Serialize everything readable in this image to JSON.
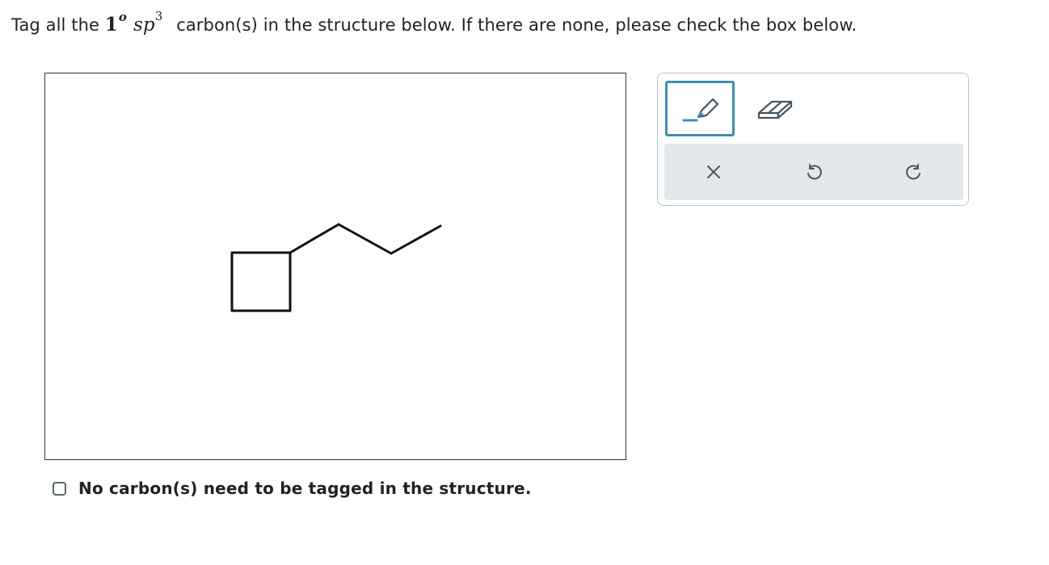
{
  "question": {
    "prefix": "Tag all the",
    "degree_number": "1",
    "degree_superscript": "o",
    "hybridization": "sp",
    "hybridization_superscript": "3",
    "suffix": "carbon(s) in the structure below. If there are none, please check the box below."
  },
  "checkbox": {
    "label": "No carbon(s) need to be tagged in the structure.",
    "checked": false
  },
  "toolbar": {
    "tools": [
      "pencil-icon",
      "eraser-icon"
    ],
    "actions": [
      "close-icon",
      "undo-icon",
      "redo-icon"
    ],
    "active_tool": "pencil-icon"
  },
  "colors": {
    "accent": "#3f8fae",
    "action_bar_bg": "#e3e8ed",
    "icon": "#4a5560"
  }
}
